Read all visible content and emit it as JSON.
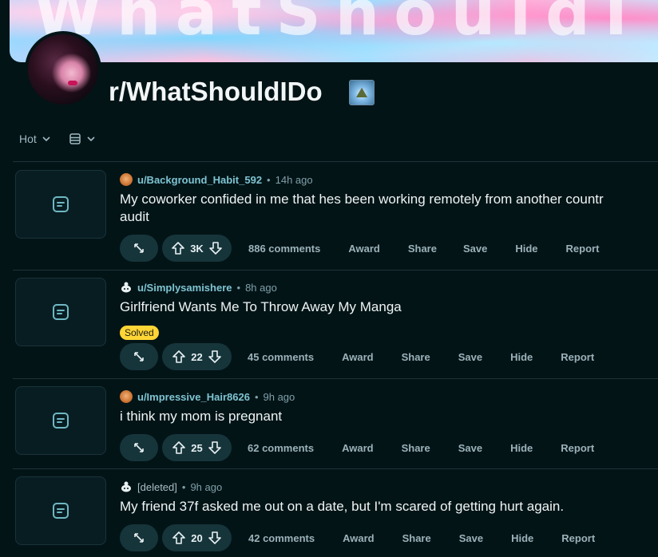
{
  "banner": {
    "watermark": "WhatShouldI"
  },
  "subreddit": {
    "name": "r/WhatShouldIDo"
  },
  "sort": {
    "label": "Hot"
  },
  "actions": {
    "award": "Award",
    "share": "Share",
    "save": "Save",
    "hide": "Hide",
    "report": "Report"
  },
  "posts": [
    {
      "author": "u/Background_Habit_592",
      "age": "14h ago",
      "title_line1": "My coworker confided in me that hes been working remotely from another countr",
      "title_line2": "audit",
      "votes": "3K",
      "comments": "886 comments"
    },
    {
      "author": "u/Simplysamishere",
      "age": "8h ago",
      "title_line1": "Girlfriend Wants Me To Throw Away My Manga",
      "flair": "Solved",
      "votes": "22",
      "comments": "45 comments"
    },
    {
      "author": "u/Impressive_Hair8626",
      "age": "9h ago",
      "title_line1": "i think my mom is pregnant",
      "votes": "25",
      "comments": "62 comments"
    },
    {
      "author": "[deleted]",
      "age": "9h ago",
      "title_line1": "My friend 37f asked me out on a date, but I'm scared of getting hurt again.",
      "votes": "20",
      "comments": "42 comments"
    }
  ]
}
